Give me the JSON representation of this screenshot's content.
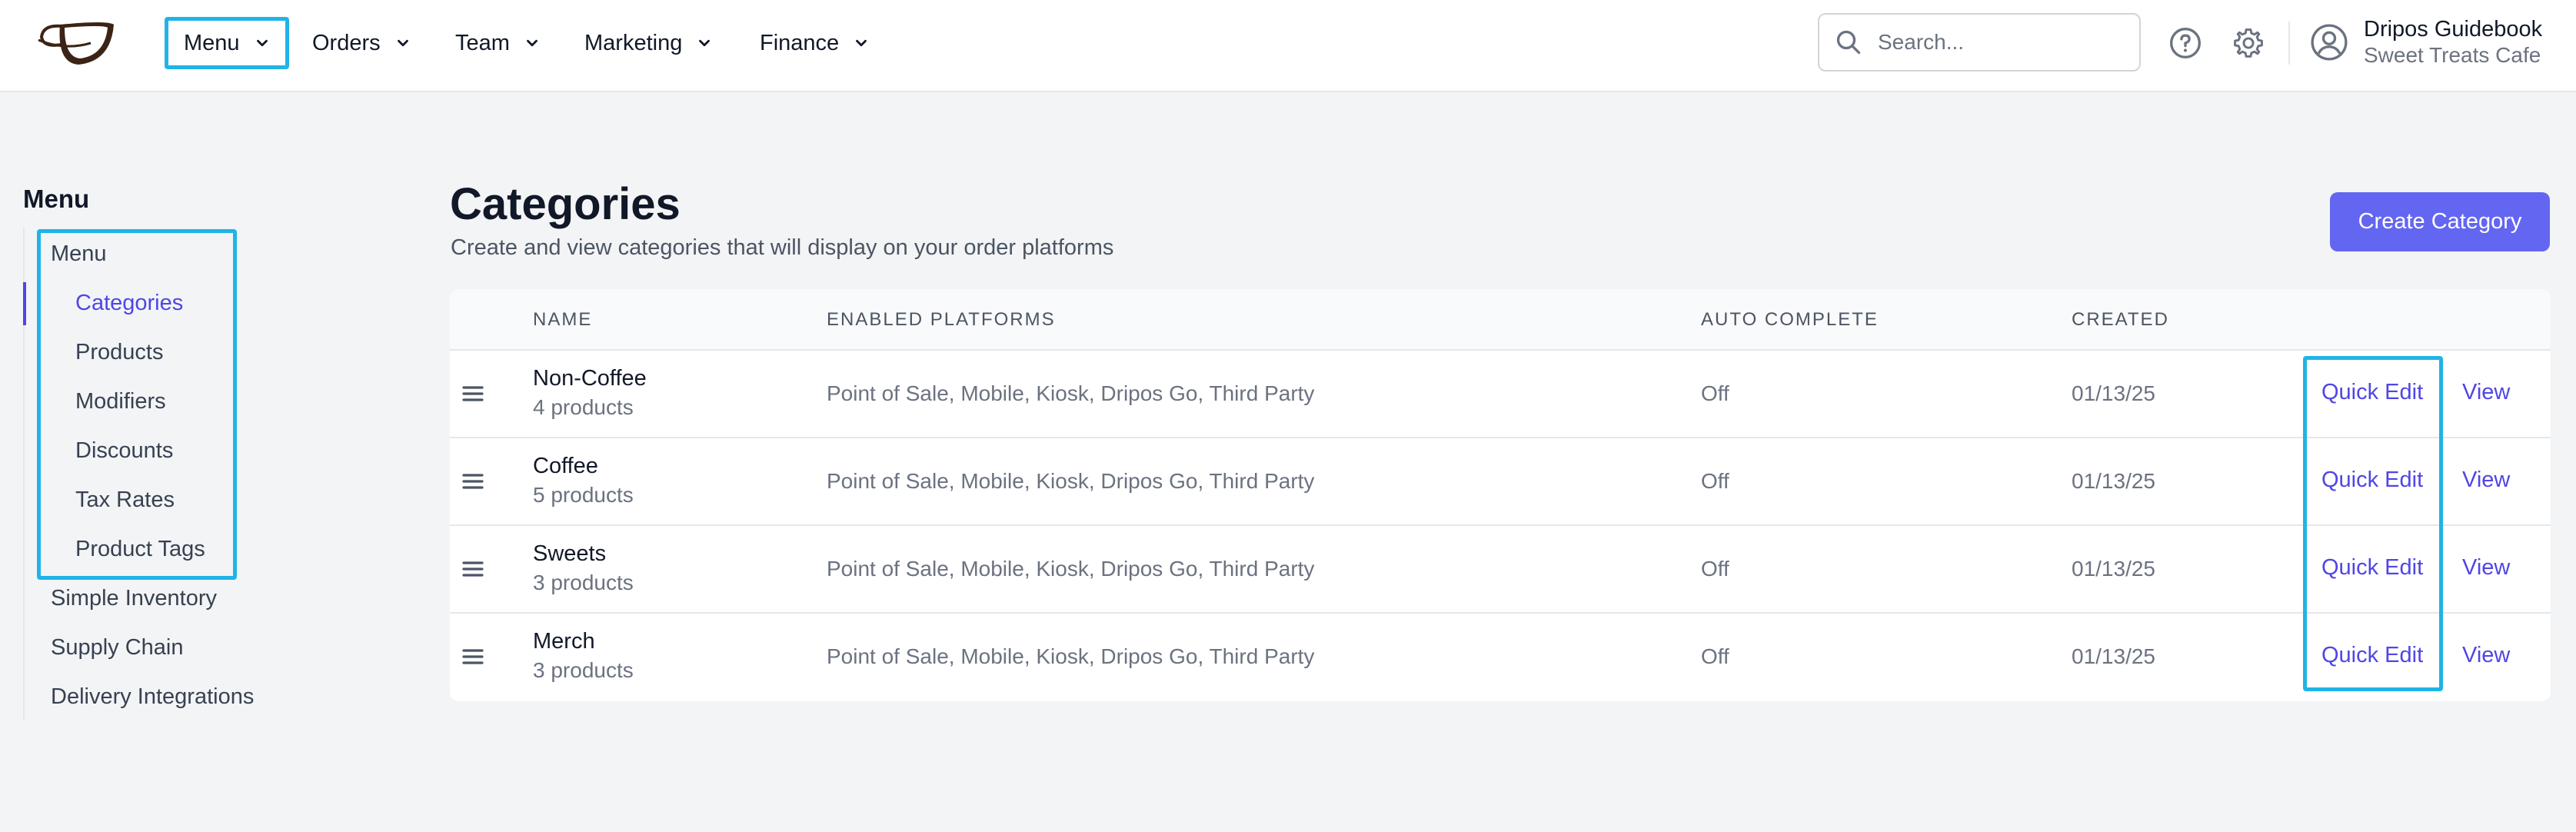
{
  "topnav": {
    "items": [
      {
        "label": "Menu"
      },
      {
        "label": "Orders"
      },
      {
        "label": "Team"
      },
      {
        "label": "Marketing"
      },
      {
        "label": "Finance"
      }
    ],
    "search_placeholder": "Search...",
    "user_name": "Dripos Guidebook",
    "location": "Sweet Treats Cafe"
  },
  "sidebar": {
    "title": "Menu",
    "items": [
      {
        "label": "Menu"
      },
      {
        "label": "Categories"
      },
      {
        "label": "Products"
      },
      {
        "label": "Modifiers"
      },
      {
        "label": "Discounts"
      },
      {
        "label": "Tax Rates"
      },
      {
        "label": "Product Tags"
      },
      {
        "label": "Simple Inventory"
      },
      {
        "label": "Supply Chain"
      },
      {
        "label": "Delivery Integrations"
      }
    ],
    "active_item": "Categories"
  },
  "main": {
    "title": "Categories",
    "subtitle": "Create and view categories that will display on your order platforms",
    "create_button": "Create Category",
    "table": {
      "columns": [
        "NAME",
        "ENABLED PLATFORMS",
        "AUTO COMPLETE",
        "CREATED"
      ],
      "rows": [
        {
          "name": "Non-Coffee",
          "count": "4 products",
          "platforms": "Point of Sale, Mobile, Kiosk, Dripos Go, Third Party",
          "auto_complete": "Off",
          "created": "01/13/25",
          "quick_edit": "Quick Edit",
          "view": "View"
        },
        {
          "name": "Coffee",
          "count": "5 products",
          "platforms": "Point of Sale, Mobile, Kiosk, Dripos Go, Third Party",
          "auto_complete": "Off",
          "created": "01/13/25",
          "quick_edit": "Quick Edit",
          "view": "View"
        },
        {
          "name": "Sweets",
          "count": "3 products",
          "platforms": "Point of Sale, Mobile, Kiosk, Dripos Go, Third Party",
          "auto_complete": "Off",
          "created": "01/13/25",
          "quick_edit": "Quick Edit",
          "view": "View"
        },
        {
          "name": "Merch",
          "count": "3 products",
          "platforms": "Point of Sale, Mobile, Kiosk, Dripos Go, Third Party",
          "auto_complete": "Off",
          "created": "01/13/25",
          "quick_edit": "Quick Edit",
          "view": "View"
        }
      ]
    }
  },
  "colors": {
    "accent": "#6366f1",
    "link": "#4f46e5",
    "highlight_box": "#1fb4e6"
  }
}
